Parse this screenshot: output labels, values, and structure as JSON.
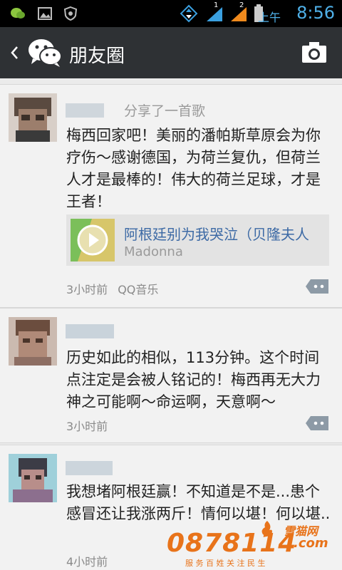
{
  "status_bar": {
    "ampm": "上午",
    "time": "8:56",
    "sim1": "1",
    "sim2": "2",
    "icons": [
      "wechat-notification-icon",
      "gallery-icon",
      "shield-icon",
      "data-arrows-icon",
      "signal-icon",
      "signal-icon",
      "battery-icon"
    ],
    "time_color": "#4fb0e8"
  },
  "title_bar": {
    "title": "朋友圈",
    "background": "#2e3134"
  },
  "posts": [
    {
      "share_note": "分享了一首歌",
      "text": "梅西回家吧！美丽的潘帕斯草原会为你疗伤～感谢德国，为荷兰复仇，但荷兰人才是最棒的！伟大的荷兰足球，才是王者！",
      "music": {
        "title": "阿根廷别为我哭泣（贝隆夫人",
        "artist": "Madonna"
      },
      "time": "3小时前",
      "source": "QQ音乐"
    },
    {
      "text": "历史如此的相似，113分钟。这个时间点注定是会被人铭记的！梅西再无大力神之可能啊～命运啊，天意啊～",
      "time": "3小时前"
    },
    {
      "text": "我想堵阿根廷赢！不知道是不是...患个感冒还让我涨两斤！情何以堪！何以堪..",
      "time": "4小时前"
    }
  ],
  "watermark": {
    "number": "0878114",
    "domain": ".com",
    "brand": "雪猫网",
    "slogan": "服 务 百 姓   关 注 民 生"
  },
  "colors": {
    "link": "#3d6aa5",
    "meta": "#8a8a8a",
    "watermark": "#e8731a"
  }
}
